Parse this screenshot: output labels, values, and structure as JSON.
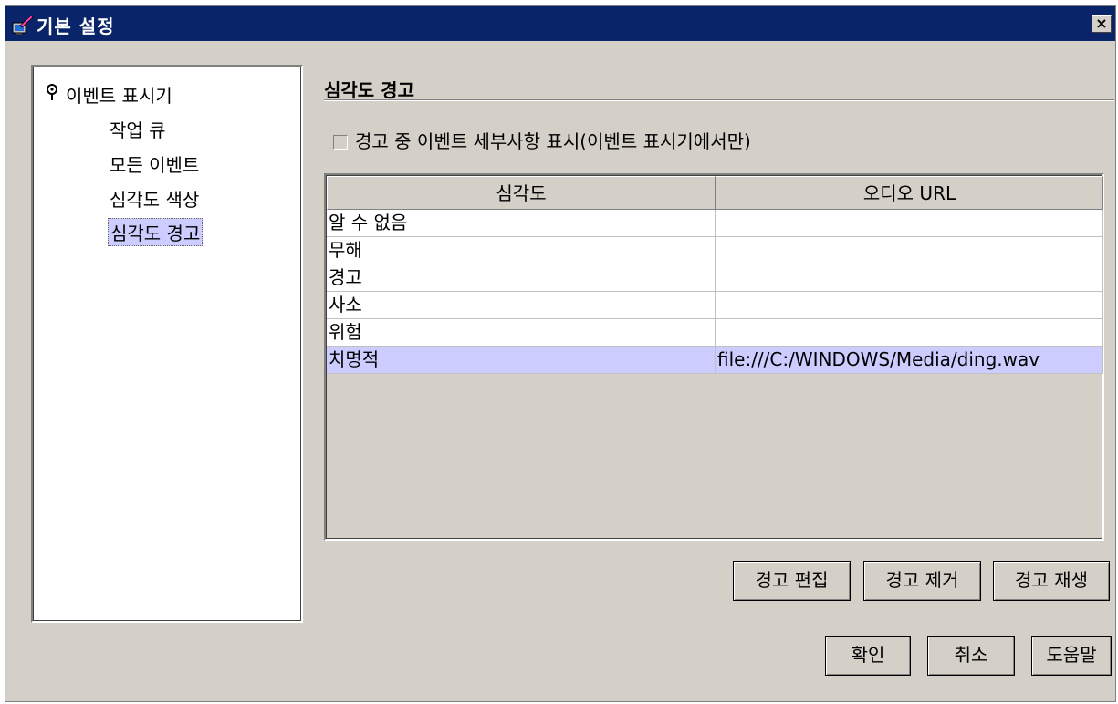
{
  "window": {
    "title": "기본 설정",
    "close_label": "×"
  },
  "nav": {
    "root_label": "이벤트 표시기",
    "items": [
      {
        "label": "작업 큐"
      },
      {
        "label": "모든 이벤트"
      },
      {
        "label": "심각도 색상"
      },
      {
        "label": "심각도 경고",
        "selected": true
      }
    ]
  },
  "section": {
    "title": "심각도 경고",
    "checkbox_label": "경고 중 이벤트 세부사항 표시(이벤트 표시기에서만)",
    "checkbox_checked": false
  },
  "table": {
    "columns": [
      "심각도",
      "오디오 URL"
    ],
    "rows": [
      {
        "severity": "알 수 없음",
        "url": ""
      },
      {
        "severity": "무해",
        "url": ""
      },
      {
        "severity": "경고",
        "url": ""
      },
      {
        "severity": "사소",
        "url": ""
      },
      {
        "severity": "위험",
        "url": ""
      },
      {
        "severity": "치명적",
        "url": "file:///C:/WINDOWS/Media/ding.wav",
        "selected": true
      }
    ]
  },
  "actions": {
    "edit_alert": "경고 편집",
    "remove_alert": "경고 제거",
    "play_alert": "경고 재생"
  },
  "footer": {
    "ok": "확인",
    "cancel": "취소",
    "help": "도움말"
  },
  "colors": {
    "titlebar": "#0a246a",
    "selection": "#ccccff",
    "dialog_bg": "#d4d0c8"
  }
}
